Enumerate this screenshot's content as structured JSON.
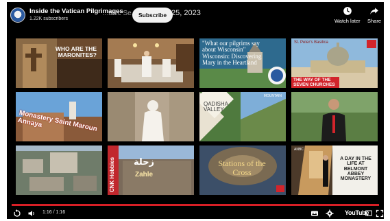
{
  "header": {
    "channel_name": "Inside the Vatican Pilgrimages",
    "subscribers": "1.22K subscribers",
    "video_title_partial": "...anic Se...",
    "video_date_partial": "25, 2023",
    "subscribe_label": "Subscribe",
    "watch_later_label": "Watch later",
    "share_label": "Share"
  },
  "tiles": [
    {
      "text": "WHO ARE THE MARONITES?"
    },
    {
      "text": ""
    },
    {
      "text": "\"What our pilgrims say about Wisconsin\" Wisconsin: Discovering Mary in the Heartland"
    },
    {
      "top_label": "St. Peter's Basilica",
      "text": "THE WAY OF THE SEVEN CHURCHES"
    },
    {
      "text": "Monastery Saint Maroun Annaya"
    },
    {
      "text": ""
    },
    {
      "text": "QADISHA VALLEY",
      "badge": "MOUNTAIN"
    },
    {
      "text": ""
    },
    {
      "text": ""
    },
    {
      "side_label": "CNK Hobbies",
      "text": "Zahle",
      "arabic": "زحلة"
    },
    {
      "text": "Stations of the Cross"
    },
    {
      "text": "A DAY IN THE LIFE AT BELMONT ABBEY MONASTERY",
      "badge": "ANBC"
    }
  ],
  "player": {
    "time_display": "1:16 / 1:16",
    "logo": "YouTube",
    "progress_fraction": 1.0
  },
  "colors": {
    "progress": "#d81f26",
    "subscribe_bg": "#f1f1f1"
  }
}
